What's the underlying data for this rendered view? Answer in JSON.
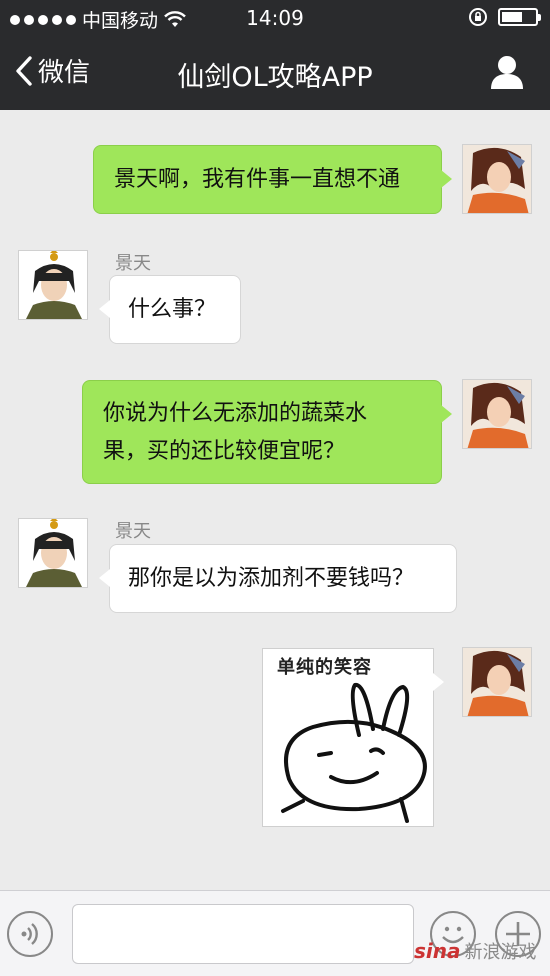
{
  "status_bar": {
    "carrier": "中国移动",
    "time": "14:09"
  },
  "nav": {
    "back_label": "微信",
    "title": "仙剑OL攻略APP",
    "person_icon": "person-icon"
  },
  "messages": [
    {
      "side": "right",
      "text_lines": [
        "景天啊，我有件事一直想不通"
      ]
    },
    {
      "side": "left",
      "sender": "景天",
      "text_lines": [
        "什么事？"
      ]
    },
    {
      "side": "right",
      "text_lines": [
        "你说为什么无添加的蔬菜水",
        "果，买的还比较便宜呢？"
      ]
    },
    {
      "side": "left",
      "sender": "景天",
      "text_lines": [
        "那你是以为添加剂不要钱吗？"
      ]
    },
    {
      "side": "right",
      "sticker_caption": "单纯的笑容"
    }
  ],
  "input_bar": {
    "voice_icon": "voice-icon",
    "emoji_icon": "emoji-icon",
    "plus_icon": "plus-icon"
  },
  "watermark": {
    "logo": "sina",
    "text": "新浪游戏"
  },
  "colors": {
    "header_bg": "#2a2b2d",
    "chat_bg": "#ebebeb",
    "green_bubble": "#9fe65a",
    "white_bubble": "#ffffff"
  }
}
